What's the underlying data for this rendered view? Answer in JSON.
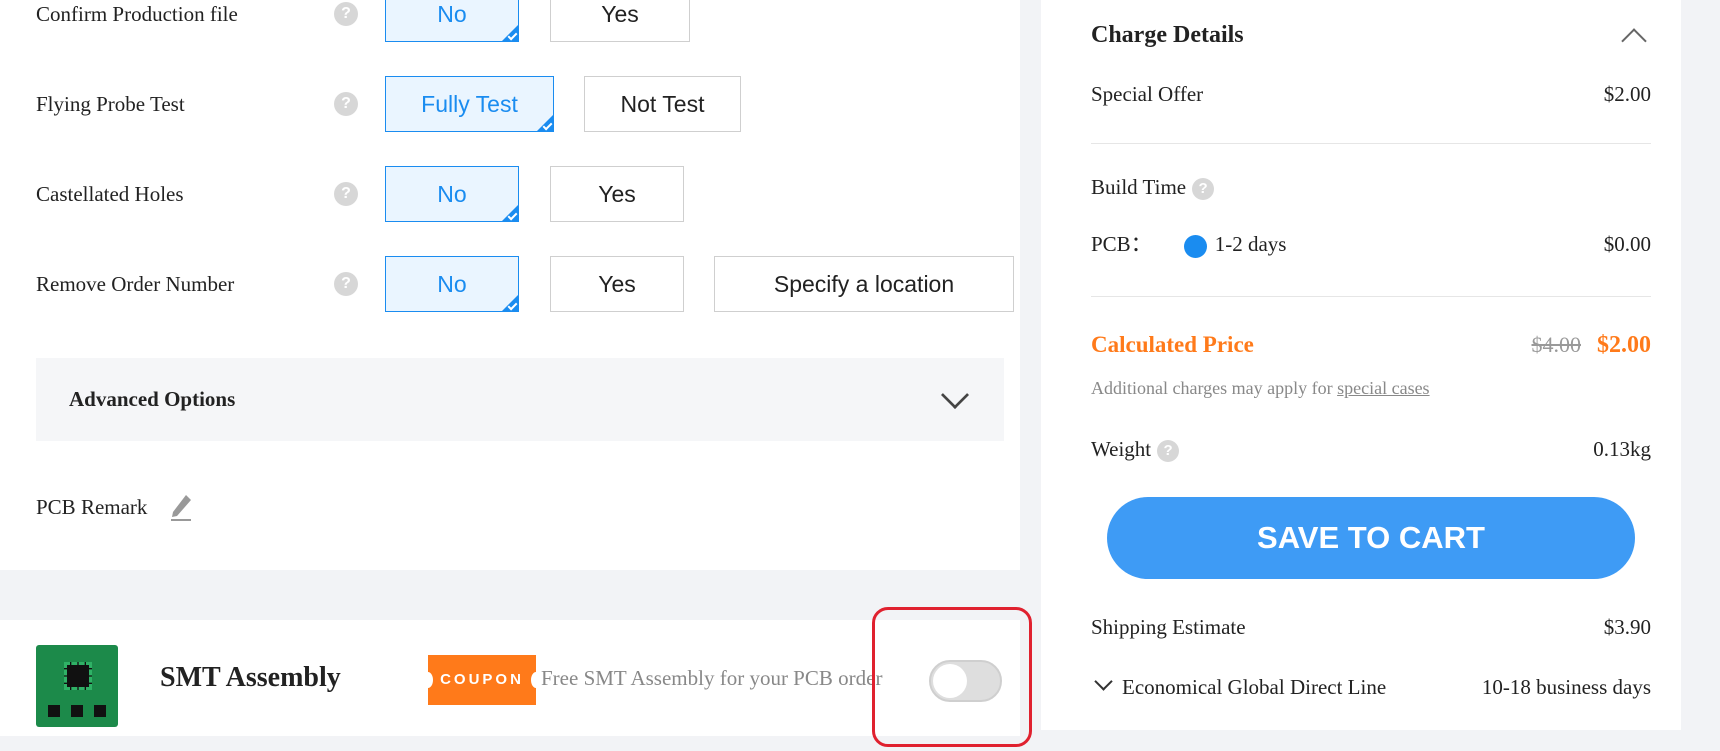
{
  "options": [
    {
      "label": "Confirm Production file",
      "choices": [
        "No",
        "Yes"
      ],
      "selected": 0
    },
    {
      "label": "Flying Probe Test",
      "choices": [
        "Fully Test",
        "Not Test"
      ],
      "selected": 0
    },
    {
      "label": "Castellated Holes",
      "choices": [
        "No",
        "Yes"
      ],
      "selected": 0
    },
    {
      "label": "Remove Order Number",
      "choices": [
        "No",
        "Yes",
        "Specify a location"
      ],
      "selected": 0
    }
  ],
  "help_glyph": "?",
  "advanced": {
    "title": "Advanced Options"
  },
  "remark": {
    "label": "PCB Remark"
  },
  "smt": {
    "title": "SMT Assembly",
    "coupon": "COUPON",
    "promo": "Free SMT Assembly for your PCB order",
    "toggle_on": false
  },
  "charge": {
    "title": "Charge Details",
    "special_offer_label": "Special Offer",
    "special_offer_value": "$2.00",
    "build_time_label": "Build Time",
    "pcb_label": "PCB：",
    "pcb_option": "1-2 days",
    "pcb_value": "$0.00",
    "calc_label": "Calculated Price",
    "old_price": "$4.00",
    "new_price": "$2.00",
    "note_prefix": "Additional charges may apply for ",
    "note_link": "special cases",
    "weight_label": "Weight",
    "weight_value": "0.13kg",
    "cart_button": "SAVE TO CART",
    "ship_label": "Shipping Estimate",
    "ship_value": "$3.90",
    "ship_method": "Economical Global Direct Line",
    "ship_days": "10-18 business days"
  },
  "colors": {
    "accent": "#1a8cf0",
    "orange": "#ff7a1a",
    "cart": "#3e9bf5",
    "highlight": "#e0212f"
  }
}
